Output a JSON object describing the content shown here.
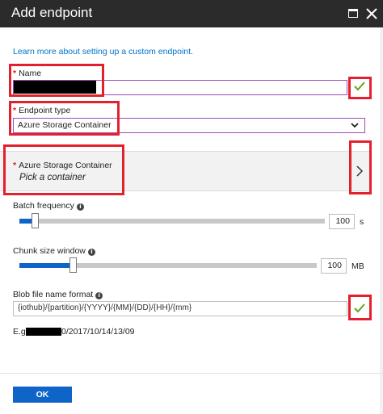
{
  "window": {
    "title": "Add endpoint"
  },
  "learn_link": "Learn more about setting up a custom endpoint.",
  "name_field": {
    "required_mark": "*",
    "label": "Name",
    "value": ""
  },
  "endpoint_type": {
    "required_mark": "*",
    "label": "Endpoint type",
    "selected": "Azure Storage Container"
  },
  "container_picker": {
    "required_mark": "*",
    "label": "Azure Storage Container",
    "placeholder": "Pick a container"
  },
  "batch_frequency": {
    "label": "Batch frequency",
    "value": "100",
    "unit": "s",
    "slider_fraction": 0.05
  },
  "chunk_size": {
    "label": "Chunk size window",
    "value": "100",
    "unit": "MB",
    "slider_fraction": 0.18
  },
  "blob_format": {
    "label": "Blob file name format",
    "value": "{iothub}/{partition}/{YYYY}/{MM}/{DD}/{HH}/{mm}"
  },
  "example": {
    "prefix": "E.g.",
    "suffix": "0/2017/10/14/13/09"
  },
  "footer": {
    "ok_label": "OK"
  },
  "icons": {
    "info": "i",
    "valid": "checkmark-icon",
    "chevron_down": "chevron-down-icon",
    "chevron_right": "chevron-right-icon"
  },
  "colors": {
    "titlebar": "#2b2b2b",
    "accent_blue": "#0f64c8",
    "link": "#0072c6",
    "focus_border": "#9b4bb4",
    "check_green": "#5ea81f",
    "annotation_red": "#e4202e"
  }
}
